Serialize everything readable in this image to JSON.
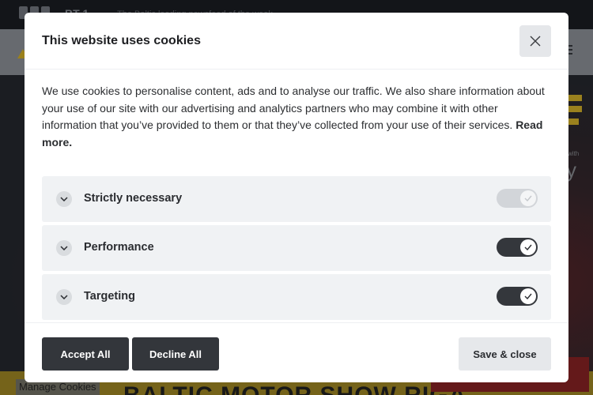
{
  "background": {
    "logo_text": "BT 1",
    "tagline": "The Baltic leading newsfeed of the week",
    "hero_partial_text": "y",
    "hero_small_text": "with",
    "banner_text": "BALTIC MOTOR SHOW RIGA",
    "manage_cookies": "Manage Cookies"
  },
  "dialog": {
    "title": "This website uses cookies",
    "body_text": "We use cookies to personalise content, ads and to analyse our traffic. We also share information about your use of our site with our advertising and analytics partners who may combine it with other information that you’ve provided to them or that they’ve collected from your use of their services.",
    "read_more": "Read more.",
    "categories": [
      {
        "label": "Strictly necessary",
        "state": "on",
        "disabled": true
      },
      {
        "label": "Performance",
        "state": "on",
        "disabled": false
      },
      {
        "label": "Targeting",
        "state": "on",
        "disabled": false
      }
    ],
    "buttons": {
      "accept_all": "Accept All",
      "decline_all": "Decline All",
      "save_close": "Save & close"
    }
  },
  "colors": {
    "dark_button": "#33363b",
    "light_button": "#e6e8eb",
    "row_background": "#f0f2f4",
    "toggle_on": "#34373c",
    "toggle_disabled": "#d2d5d9"
  }
}
